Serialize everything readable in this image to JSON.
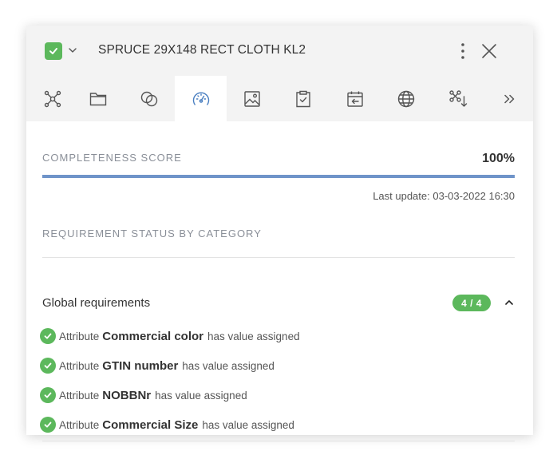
{
  "header": {
    "title": "SPRUCE 29X148 RECT CLOTH KL2",
    "status_color": "#5cb85c",
    "status_icon": "check-icon",
    "more_icon": "more-vertical-icon",
    "close_icon": "close-icon"
  },
  "tabs": [
    {
      "name": "associations",
      "icon": "network-icon",
      "active": false
    },
    {
      "name": "categories",
      "icon": "folder-icon",
      "active": false
    },
    {
      "name": "relations",
      "icon": "link-circles-icon",
      "active": false
    },
    {
      "name": "completeness",
      "icon": "gauge-icon",
      "active": true
    },
    {
      "name": "media",
      "icon": "image-icon",
      "active": false
    },
    {
      "name": "tasks",
      "icon": "clipboard-check-icon",
      "active": false
    },
    {
      "name": "history",
      "icon": "calendar-back-icon",
      "active": false
    },
    {
      "name": "channels",
      "icon": "globe-icon",
      "active": false
    },
    {
      "name": "structure",
      "icon": "tree-sort-icon",
      "active": false
    },
    {
      "name": "more-tabs",
      "icon": "double-chevron-right-icon",
      "active": false
    }
  ],
  "completeness": {
    "label": "COMPLETENESS SCORE",
    "score": "100%",
    "progress_fraction": 1.0,
    "progress_color": "#6f94c9",
    "last_update": "Last update: 03-03-2022 16:30"
  },
  "requirements": {
    "label": "REQUIREMENT STATUS BY CATEGORY",
    "group": {
      "title": "Global requirements",
      "badge": "4 / 4",
      "expanded": true,
      "items": [
        {
          "prefix": "Attribute",
          "name": "Commercial color",
          "suffix": "has value assigned"
        },
        {
          "prefix": "Attribute",
          "name": "GTIN number",
          "suffix": "has value assigned"
        },
        {
          "prefix": "Attribute",
          "name": "NOBBNr",
          "suffix": "has value assigned"
        },
        {
          "prefix": "Attribute",
          "name": "Commercial Size",
          "suffix": "has value assigned"
        }
      ]
    }
  }
}
